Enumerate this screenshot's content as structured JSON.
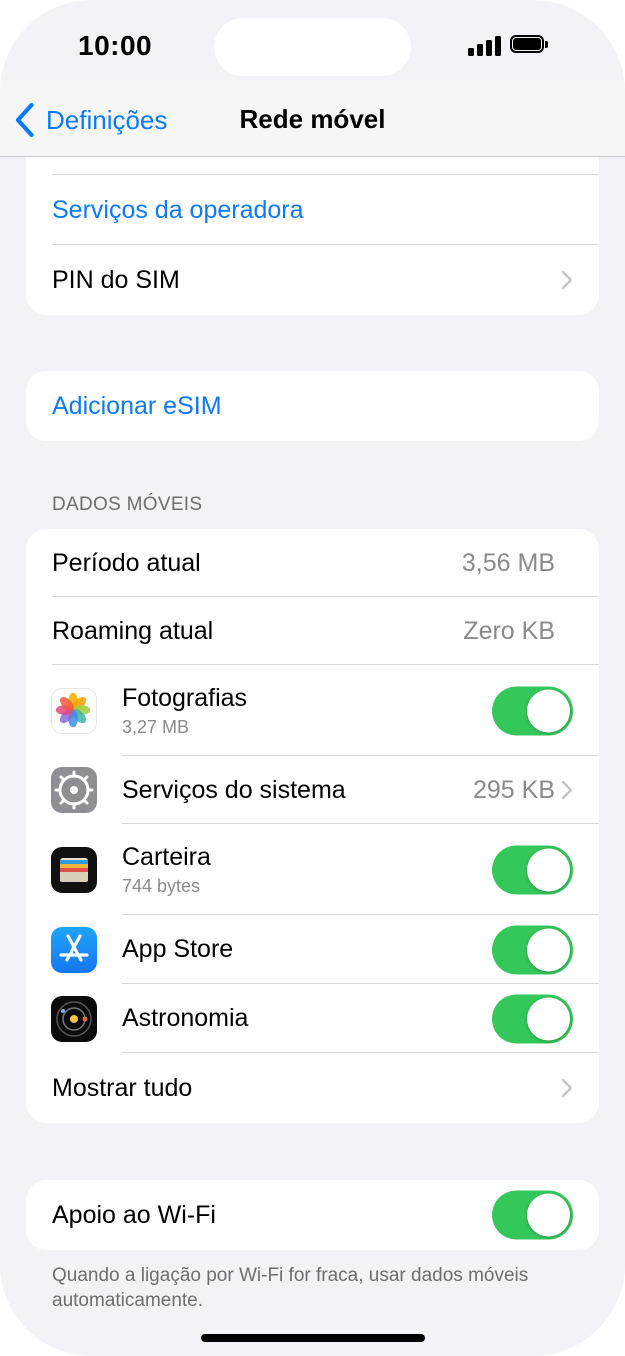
{
  "status_bar": {
    "time": "10:00"
  },
  "nav": {
    "back_label": "Definições",
    "title": "Rede móvel"
  },
  "carrier_group": {
    "items": [
      {
        "label": "Serviços da operadora"
      },
      {
        "label": "PIN do SIM"
      }
    ]
  },
  "esim_group": {
    "label": "Adicionar eSIM"
  },
  "mobile_data": {
    "header": "DADOS MÓVEIS",
    "current_period": {
      "label": "Período atual",
      "value": "3,56 MB"
    },
    "current_roaming": {
      "label": "Roaming atual",
      "value": "Zero KB"
    },
    "apps": [
      {
        "name": "Fotografias",
        "usage": "3,27 MB",
        "enabled": true,
        "icon": "photos-icon"
      },
      {
        "name": "Serviços do sistema",
        "value": "295 KB",
        "icon": "settings-gear-icon"
      },
      {
        "name": "Carteira",
        "usage": "744 bytes",
        "enabled": true,
        "icon": "wallet-icon"
      },
      {
        "name": "App Store",
        "enabled": true,
        "icon": "app-store-icon"
      },
      {
        "name": "Astronomia",
        "enabled": true,
        "icon": "astronomy-icon"
      }
    ],
    "show_all": "Mostrar tudo"
  },
  "wifi_assist": {
    "label": "Apoio ao Wi-Fi",
    "enabled": true,
    "footer": "Quando a ligação por Wi-Fi for fraca, usar dados móveis automaticamente."
  },
  "colors": {
    "accent": "#0a7aff",
    "toggle_on": "#34c759",
    "background": "#f2f2f7"
  }
}
